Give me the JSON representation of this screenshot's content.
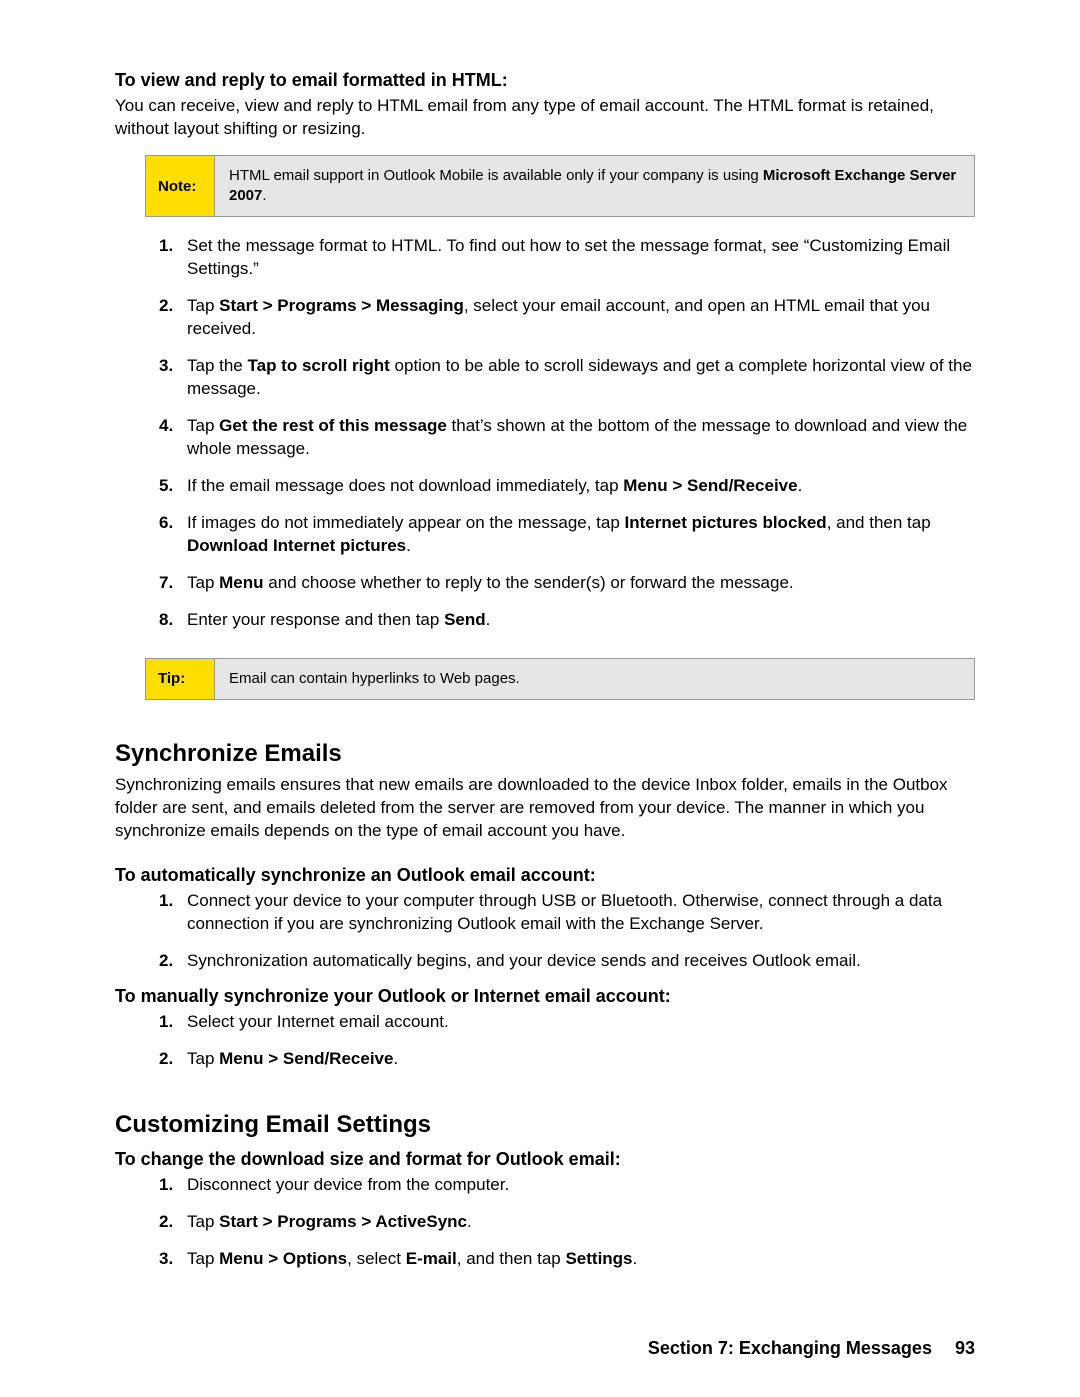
{
  "block1": {
    "heading": "To view and reply to email formatted in HTML:",
    "intro": "You can receive, view and reply to HTML email from any type of email account. The HTML format is retained, without layout shifting or resizing.",
    "note_label": "Note:",
    "note_body_pre": "HTML email support in Outlook Mobile is available only if your company is using ",
    "note_body_bold": "Microsoft Exchange Server 2007",
    "note_body_post": ".",
    "steps": [
      {
        "n": "1",
        "html": "Set the message format to HTML. To find out how to set the message format, see “Customizing Email Settings.”"
      },
      {
        "n": "2",
        "html": "Tap <b>Start > Programs > Messaging</b>, select your email account, and open an HTML email that you received."
      },
      {
        "n": "3",
        "html": "Tap the <b>Tap to scroll right</b> option to be able to scroll sideways and get a complete horizontal view of the message."
      },
      {
        "n": "4",
        "html": "Tap <b>Get the rest of this message</b> that’s shown at the bottom of the message to download and view the whole message."
      },
      {
        "n": "5",
        "html": "If the email message does not download immediately, tap <b>Menu > Send/Receive</b>."
      },
      {
        "n": "6",
        "html": "If images do not immediately appear on the message, tap <b>Internet pictures blocked</b>, and then tap <b>Download Internet pictures</b>."
      },
      {
        "n": "7",
        "html": "Tap <b>Menu</b> and choose whether to reply to the sender(s) or forward the message."
      },
      {
        "n": "8",
        "html": "Enter your response and then tap <b>Send</b>."
      }
    ],
    "tip_label": "Tip:",
    "tip_body": "Email can contain hyperlinks to Web pages."
  },
  "block2": {
    "heading": "Synchronize Emails",
    "intro": "Synchronizing emails ensures that new emails are downloaded to the device Inbox folder, emails in the Outbox folder are sent, and emails deleted from the server are removed from your device. The manner in which you synchronize emails depends on the type of email account you have.",
    "sub1": "To automatically synchronize an Outlook email account:",
    "sub1_steps": [
      {
        "n": "1",
        "html": "Connect your device to your computer through USB or Bluetooth. Otherwise, connect through a data connection if you are synchronizing Outlook email with the Exchange Server."
      },
      {
        "n": "2",
        "html": "Synchronization automatically begins, and your device sends and receives Outlook email."
      }
    ],
    "sub2": "To manually synchronize your Outlook or Internet email account:",
    "sub2_steps": [
      {
        "n": "1",
        "html": "Select your Internet email account."
      },
      {
        "n": "2",
        "html": "Tap <b>Menu > Send/Receive</b>."
      }
    ]
  },
  "block3": {
    "heading": "Customizing Email Settings",
    "sub1": "To change the download size and format for Outlook email:",
    "sub1_steps": [
      {
        "n": "1",
        "html": "Disconnect your device from the computer."
      },
      {
        "n": "2",
        "html": "Tap <b>Start > Programs > ActiveSync</b>."
      },
      {
        "n": "3",
        "html": "Tap <b>Menu > Options</b>, select <b>E-mail</b>, and then tap <b>Settings</b>."
      }
    ]
  },
  "footer": {
    "section": "Section 7: Exchanging Messages",
    "page": "93"
  }
}
